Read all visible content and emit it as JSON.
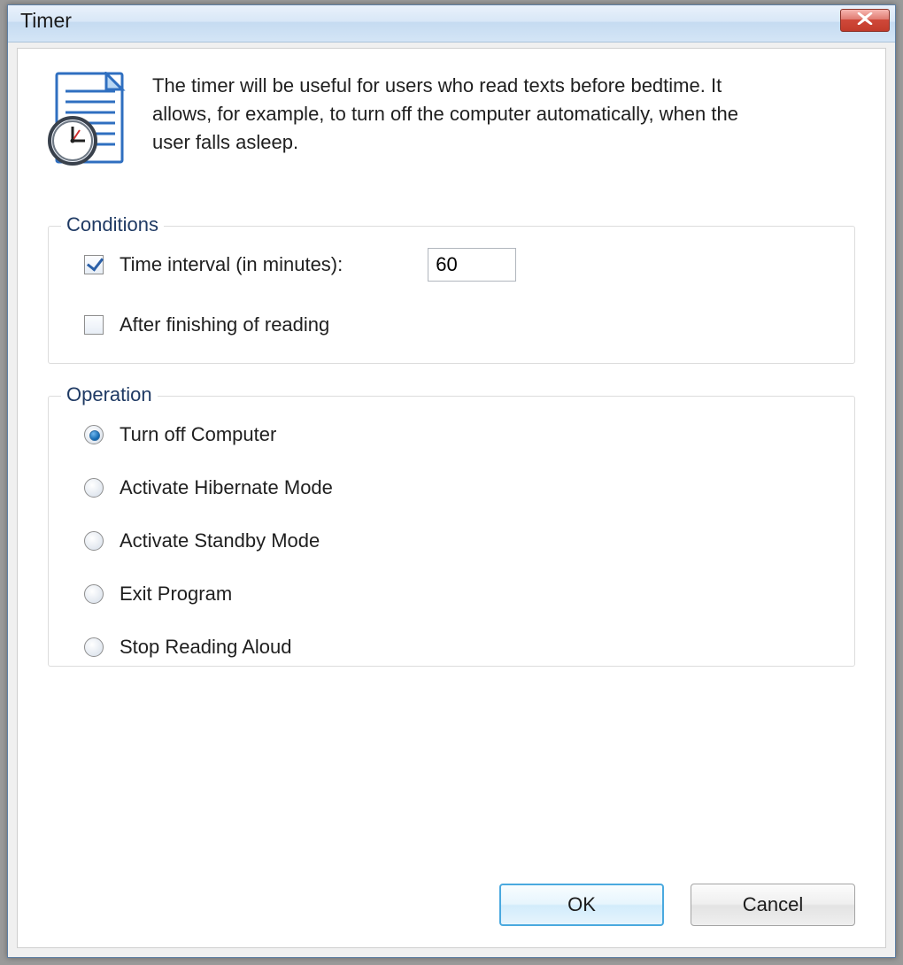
{
  "window": {
    "title": "Timer"
  },
  "intro": {
    "text": "The timer will be useful for users who read texts before bedtime. It allows, for example, to turn off the computer automatically, when the user falls asleep."
  },
  "conditions": {
    "legend": "Conditions",
    "interval": {
      "label": "Time interval (in minutes):",
      "value": "60",
      "checked": true
    },
    "after_reading": {
      "label": "After finishing of reading",
      "checked": false
    }
  },
  "operation": {
    "legend": "Operation",
    "options": [
      {
        "label": "Turn off Computer",
        "selected": true
      },
      {
        "label": "Activate Hibernate Mode",
        "selected": false
      },
      {
        "label": "Activate Standby Mode",
        "selected": false
      },
      {
        "label": "Exit Program",
        "selected": false
      },
      {
        "label": "Stop Reading Aloud",
        "selected": false
      }
    ]
  },
  "buttons": {
    "ok": "OK",
    "cancel": "Cancel"
  }
}
